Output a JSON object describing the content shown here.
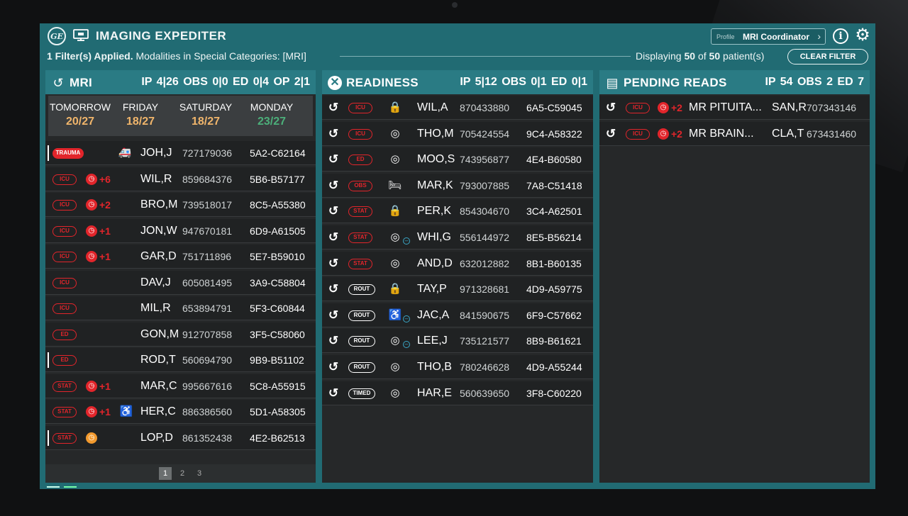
{
  "app": {
    "title": "IMAGING EXPEDITER",
    "logo": "GE"
  },
  "profile": {
    "label": "Profile",
    "value": "MRI Coordinator"
  },
  "filter": {
    "applied": "1 Filter(s) Applied.",
    "desc": "Modalities in Special Categories: [MRI]"
  },
  "displaying": {
    "prefix": "Displaying",
    "shown": "50",
    "of": "of",
    "total": "50",
    "suffix": "patient(s)"
  },
  "clear_filter": "CLEAR FILTER",
  "mri": {
    "title": "MRI",
    "stats": "IP 4|26  OBS 0|0  ED 0|4  OP 2|1",
    "days": [
      {
        "label": "TOMORROW",
        "value": "20/27",
        "color": "#f0b56b"
      },
      {
        "label": "FRIDAY",
        "value": "18/27",
        "color": "#f0b56b"
      },
      {
        "label": "SATURDAY",
        "value": "18/27",
        "color": "#f0b56b"
      },
      {
        "label": "MONDAY",
        "value": "23/27",
        "color": "#4caf7a"
      }
    ],
    "rows": [
      {
        "tag": "TRAUMA",
        "clock": "",
        "plus": "",
        "name": "JOH,J",
        "mrn": "727179036",
        "acc": "5A2-C62164",
        "bar": true,
        "icon": "ambulance"
      },
      {
        "tag": "ICU",
        "clock": "red",
        "plus": "+6",
        "name": "WIL,R",
        "mrn": "859684376",
        "acc": "5B6-B57177"
      },
      {
        "tag": "ICU",
        "clock": "red",
        "plus": "+2",
        "name": "BRO,M",
        "mrn": "739518017",
        "acc": "8C5-A55380"
      },
      {
        "tag": "ICU",
        "clock": "red",
        "plus": "+1",
        "name": "JON,W",
        "mrn": "947670181",
        "acc": "6D9-A61505"
      },
      {
        "tag": "ICU",
        "clock": "red",
        "plus": "+1",
        "name": "GAR,D",
        "mrn": "751711896",
        "acc": "5E7-B59010"
      },
      {
        "tag": "ICU",
        "clock": "",
        "plus": "",
        "name": "DAV,J",
        "mrn": "605081495",
        "acc": "3A9-C58804"
      },
      {
        "tag": "ICU",
        "clock": "",
        "plus": "",
        "name": "MIL,R",
        "mrn": "653894791",
        "acc": "5F3-C60844"
      },
      {
        "tag": "ED",
        "clock": "",
        "plus": "",
        "name": "GON,M",
        "mrn": "912707858",
        "acc": "3F5-C58060"
      },
      {
        "tag": "ED",
        "clock": "",
        "plus": "",
        "name": "ROD,T",
        "mrn": "560694790",
        "acc": "9B9-B51102",
        "bar": true
      },
      {
        "tag": "STAT",
        "clock": "red",
        "plus": "+1",
        "name": "MAR,C",
        "mrn": "995667616",
        "acc": "5C8-A55915"
      },
      {
        "tag": "STAT",
        "clock": "red",
        "plus": "+1",
        "name": "HER,C",
        "mrn": "886386560",
        "acc": "5D1-A58305",
        "icon": "wheelchair"
      },
      {
        "tag": "STAT",
        "clock": "orange",
        "plus": "",
        "name": "LOP,D",
        "mrn": "861352438",
        "acc": "4E2-B62513",
        "bar": true
      }
    ],
    "pages": [
      "1",
      "2",
      "3"
    ]
  },
  "readiness": {
    "title": "READINESS",
    "stats": "IP 5|12  OBS 0|1  ED 0|1",
    "rows": [
      {
        "tag": "ICU",
        "status": "lock",
        "name": "WIL,A",
        "mrn": "870433880",
        "acc": "6A5-C59045"
      },
      {
        "tag": "ICU",
        "status": "scanner",
        "name": "THO,M",
        "mrn": "705424554",
        "acc": "9C4-A58322"
      },
      {
        "tag": "ED",
        "status": "scanner",
        "name": "MOO,S",
        "mrn": "743956877",
        "acc": "4E4-B60580"
      },
      {
        "tag": "OBS",
        "status": "bed",
        "name": "MAR,K",
        "mrn": "793007885",
        "acc": "7A8-C51418"
      },
      {
        "tag": "STAT",
        "status": "lock",
        "name": "PER,K",
        "mrn": "854304670",
        "acc": "3C4-A62501"
      },
      {
        "tag": "STAT",
        "status": "scanner",
        "minus": true,
        "name": "WHI,G",
        "mrn": "556144972",
        "acc": "8E5-B56214"
      },
      {
        "tag": "STAT",
        "status": "scanner",
        "name": "AND,D",
        "mrn": "632012882",
        "acc": "8B1-B60135"
      },
      {
        "tag": "ROUT",
        "status": "lock",
        "name": "TAY,P",
        "mrn": "971328681",
        "acc": "4D9-A59775"
      },
      {
        "tag": "ROUT",
        "status": "wheelchair",
        "minus": true,
        "name": "JAC,A",
        "mrn": "841590675",
        "acc": "6F9-C57662"
      },
      {
        "tag": "ROUT",
        "status": "scanner",
        "minus": true,
        "name": "LEE,J",
        "mrn": "735121577",
        "acc": "8B9-B61621"
      },
      {
        "tag": "ROUT",
        "status": "scanner",
        "name": "THO,B",
        "mrn": "780246628",
        "acc": "4D9-A55244"
      },
      {
        "tag": "TIMED",
        "status": "scanner",
        "name": "HAR,E",
        "mrn": "560639650",
        "acc": "3F8-C60220"
      }
    ]
  },
  "pending": {
    "title": "PENDING READS",
    "stats": "IP 54  OBS 2  ED 7",
    "rows": [
      {
        "tag": "ICU",
        "plus": "+2",
        "study": "MR PITUITA...",
        "name": "SAN,R",
        "mrn": "707343146"
      },
      {
        "tag": "ICU",
        "plus": "+2",
        "study": "MR BRAIN...",
        "name": "CLA,T",
        "mrn": "673431460"
      }
    ]
  },
  "colors": {
    "teal": "#216b73",
    "header_teal": "#2a7b84",
    "alert_red": "#e2252b",
    "orange": "#f29a2e",
    "green": "#4caf7a"
  }
}
